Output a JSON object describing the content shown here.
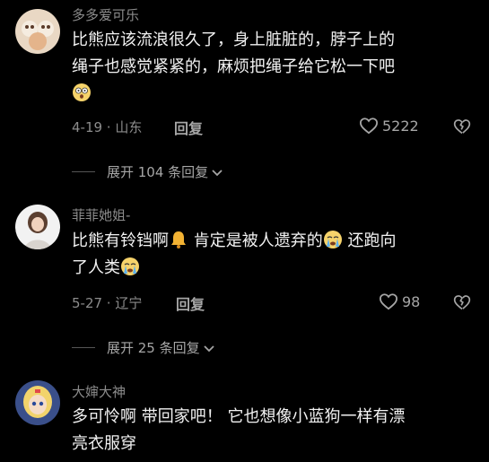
{
  "comments": [
    {
      "username": "多多爱可乐",
      "text_line1": "比熊应该流浪很久了，身上脏脏的，脖子上的",
      "text_line2": "绳子也感觉紧紧的，麻烦把绳子给它松一下吧",
      "meta": "4-19 · 山东",
      "reply_label": "回复",
      "likes": "5222",
      "expand_label": "展开 104 条回复"
    },
    {
      "username": "菲菲她姐-",
      "text_part1": "比熊有铃铛啊",
      "text_part2": " 肯定是被人遗弃的",
      "text_part3": " 还跑向",
      "text_line2": "了人类",
      "meta": "5-27 · 辽宁",
      "reply_label": "回复",
      "likes": "98",
      "expand_label": "展开 25 条回复"
    },
    {
      "username": "大婶大神",
      "text_line1": "多可怜啊 带回家吧！ 它也想像小蓝狗一样有漂",
      "text_line2": "亮衣服穿"
    }
  ],
  "icons": {
    "like": "heart-outline-icon",
    "dislike": "broken-heart-icon",
    "expand": "chevron-down-icon"
  },
  "colors": {
    "background": "#000000",
    "text": "#f2f2f2",
    "secondary": "#8c8c8c"
  }
}
